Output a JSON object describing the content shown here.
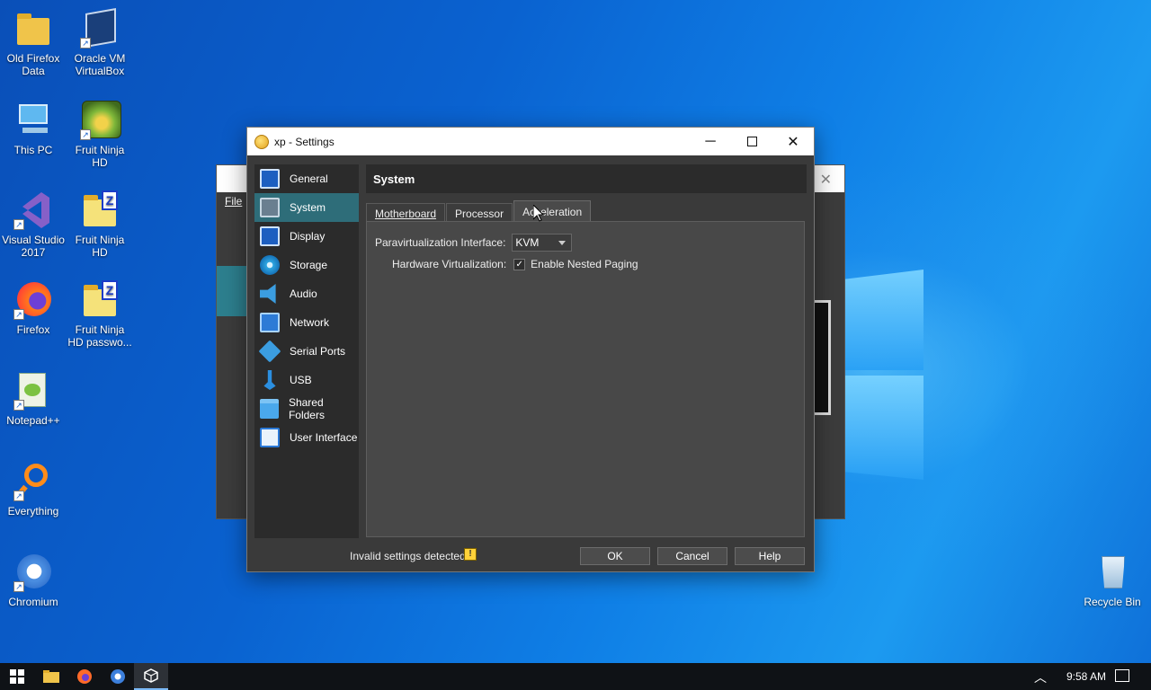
{
  "desktop": {
    "icons": [
      {
        "label": "Old Firefox Data",
        "icon": "folder-icon"
      },
      {
        "label": "Oracle VM VirtualBox",
        "icon": "virtualbox-icon"
      },
      {
        "label": "This PC",
        "icon": "computer-icon"
      },
      {
        "label": "Fruit Ninja HD",
        "icon": "fruit-ninja-icon"
      },
      {
        "label": "Visual Studio 2017",
        "icon": "visual-studio-icon"
      },
      {
        "label": "Fruit Ninja HD",
        "icon": "zip-folder-icon"
      },
      {
        "label": "Firefox",
        "icon": "firefox-icon"
      },
      {
        "label": "Fruit Ninja HD passwo...",
        "icon": "zip-folder-icon"
      },
      {
        "label": "Notepad++",
        "icon": "notepad-plus-icon"
      },
      {
        "label": "Everything",
        "icon": "search-magnifier-icon"
      },
      {
        "label": "Chromium",
        "icon": "chromium-icon"
      },
      {
        "label": "Recycle Bin",
        "icon": "recycle-bin-icon"
      }
    ]
  },
  "bg_window": {
    "menu_file": "File"
  },
  "dialog": {
    "title": "xp - Settings",
    "nav": [
      {
        "label": "General",
        "icon": "monitor-icon"
      },
      {
        "label": "System",
        "icon": "chip-icon"
      },
      {
        "label": "Display",
        "icon": "monitor-icon"
      },
      {
        "label": "Storage",
        "icon": "disc-icon"
      },
      {
        "label": "Audio",
        "icon": "speaker-icon"
      },
      {
        "label": "Network",
        "icon": "network-icon"
      },
      {
        "label": "Serial Ports",
        "icon": "serial-port-icon"
      },
      {
        "label": "USB",
        "icon": "usb-icon"
      },
      {
        "label": "Shared Folders",
        "icon": "folder-icon"
      },
      {
        "label": "User Interface",
        "icon": "window-icon"
      }
    ],
    "active_nav": "System",
    "section_title": "System",
    "tabs": [
      "Motherboard",
      "Processor",
      "Acceleration"
    ],
    "active_tab": "Acceleration",
    "paravirt_label": "Paravirtualization Interface:",
    "paravirt_value": "KVM",
    "hwvirt_label": "Hardware Virtualization:",
    "nested_paging_label": "Enable Nested Paging",
    "nested_paging_checked": true,
    "status_text": "Invalid settings detected",
    "buttons": {
      "ok": "OK",
      "cancel": "Cancel",
      "help": "Help"
    }
  },
  "taskbar": {
    "time": "9:58 AM"
  }
}
